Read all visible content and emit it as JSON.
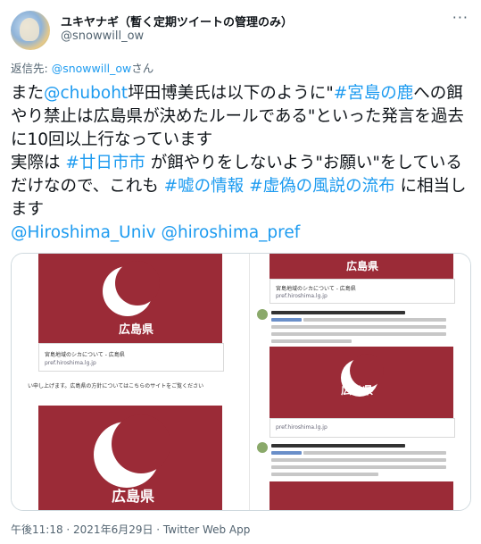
{
  "tweet": {
    "author_name": "ユキヤナギ（暫く定期ツイートの管理のみ）",
    "author_handle": "@snowwill_ow",
    "more_label": "···",
    "reply_prefix": "返信先: ",
    "reply_to": "@snowwill_ow",
    "reply_suffix": "さん",
    "text": {
      "p1": "また",
      "m1": "@chuboht",
      "p2": "坪田博美氏は以下のように\"",
      "h1": "#宮島の鹿",
      "p3": "への餌やり禁止は広島県が決めたルールである\"といった発言を過去に10回以上行なっています",
      "p4": "実際は ",
      "h2": "#廿日市市",
      "p5": " が餌やりをしないよう\"お願い\"をしているだけなので、これも ",
      "h3": "#嘘の情報",
      "p6": " ",
      "h4": "#虚偽の風説の流布",
      "p7": " に相当します",
      "m2": "@Hiroshima_Univ",
      "p8": " ",
      "m3": "@hiroshima_pref"
    },
    "timestamp": "午後11:18 · 2021年6月29日 · Twitter Web App"
  },
  "media": {
    "pref_label": "広島県",
    "card_title": "宮島地域のシカについて - 広島県",
    "card_url": "pref.hiroshima.lg.jp",
    "left_text": "い申し上げます。広島県の方針についてはこちらのサイトをご覧ください"
  },
  "colors": {
    "pref_red": "#9b2b37",
    "link_blue": "#1d9bf0",
    "secondary": "#536471"
  }
}
